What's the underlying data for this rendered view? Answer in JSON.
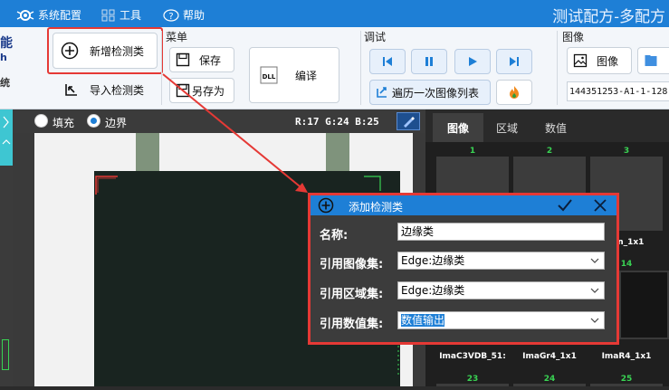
{
  "menubar": {
    "items": [
      "系统配置",
      "工具",
      "帮助"
    ],
    "app_title": "测试配方-多配方"
  },
  "ribbon": {
    "left_fragment": [
      "能",
      "h",
      "统"
    ],
    "add_class_label": "新增检测类",
    "import_class_label": "导入检测类",
    "menu_group_label": "菜单",
    "save_label": "保存",
    "save_as_label": "另存为",
    "compile_label": "编译",
    "dll_badge": "DLL",
    "debug_group_label": "调试",
    "traverse_label": "遍历一次图像列表",
    "image_group_label": "图像",
    "image_label": "图像",
    "image_name_value": "144351253-A1-1-128"
  },
  "canvas": {
    "fill_label": "填充",
    "border_label": "边界",
    "border_checked": true,
    "rgb_readout": "R:17  G:24  B:25"
  },
  "right_panel": {
    "tabs": [
      "图像",
      "区域",
      "数值"
    ],
    "active_tab": "图像",
    "top_numbers": [
      "1",
      "2",
      "3"
    ],
    "row2_number": "14",
    "row2_caption_partial": "Bcn_1x1",
    "captions": [
      "ImaC3VDB_51:",
      "ImaGr4_1x1",
      "ImaR4_1x1"
    ],
    "bottom_numbers": [
      "23",
      "24",
      "25"
    ]
  },
  "dialog": {
    "title": "添加检测类",
    "name_label": "名称:",
    "name_value": "边缘类",
    "image_set_label": "引用图像集:",
    "image_set_value": "Edge:边缘类",
    "region_set_label": "引用区域集:",
    "region_set_value": "Edge:边缘类",
    "value_set_label": "引用数值集:",
    "value_set_value": "数值输出"
  },
  "colors": {
    "accent": "#1e7fd6",
    "annotation_red": "#e53935",
    "number_green": "#39d353"
  }
}
